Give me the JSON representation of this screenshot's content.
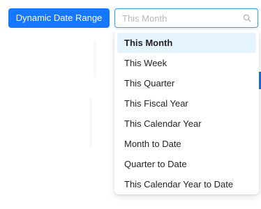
{
  "toolbar": {
    "range_button_label": "Dynamic Date Range"
  },
  "search": {
    "placeholder": "This Month",
    "value": ""
  },
  "dropdown": {
    "selected_index": 0,
    "options": [
      "This Month",
      "This Week",
      "This Quarter",
      "This Fiscal Year",
      "This Calendar Year",
      "Month to Date",
      "Quarter to Date",
      "This Calendar Year to Date"
    ]
  },
  "colors": {
    "primary": "#1677ff",
    "focus_border": "#4096ff",
    "selected_bg": "#e6f4ff"
  },
  "icons": {
    "search": "search-icon"
  }
}
